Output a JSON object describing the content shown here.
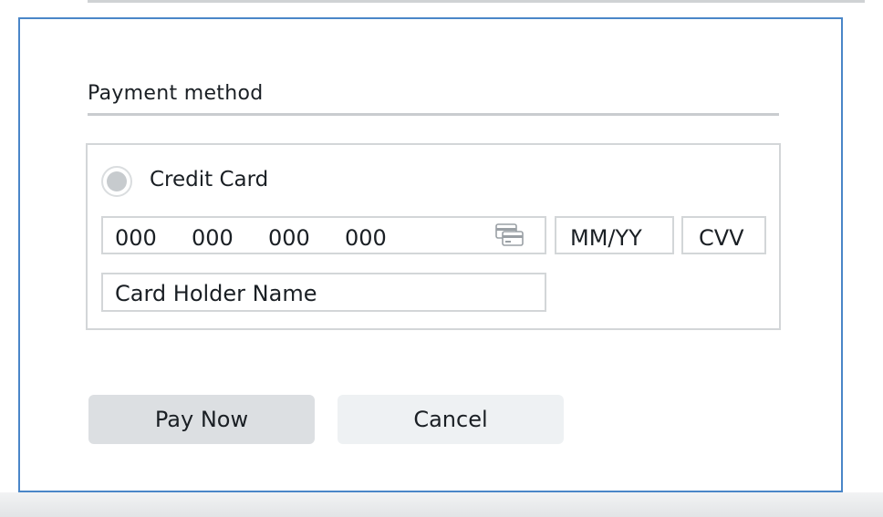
{
  "payment": {
    "section_title": "Payment method",
    "method": {
      "label": "Credit Card",
      "selected": false
    },
    "fields": {
      "card_number": {
        "groups": [
          "000",
          "000",
          "000",
          "000"
        ],
        "icon": "card-icon"
      },
      "expiry": "MM/YY",
      "cvv": "CVV",
      "holder": "Card Holder Name"
    }
  },
  "actions": {
    "pay_label": "Pay Now",
    "cancel_label": "Cancel"
  },
  "colors": {
    "panel_border": "#4a86c8",
    "button_primary": "#dcdfe2",
    "button_secondary": "#eef1f3"
  }
}
